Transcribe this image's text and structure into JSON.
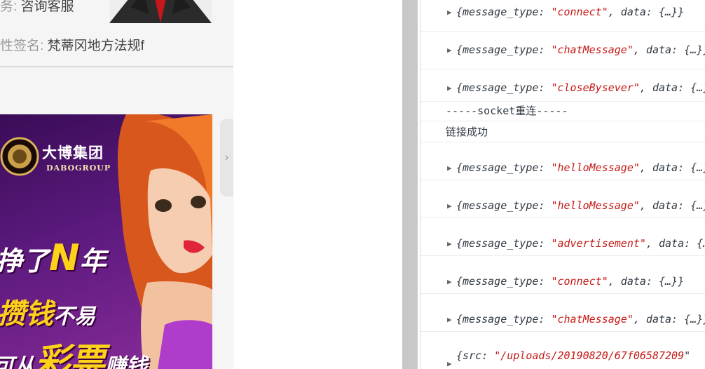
{
  "profile": {
    "service_label": "务:",
    "service_value": "咨询客服",
    "signature_label": "性签名:",
    "signature_value": "梵蒂冈地方法规f"
  },
  "ad": {
    "brand": "大博集团",
    "brand_en": "DABOGROUP",
    "line1_pre": "挣了",
    "line1_big": "N",
    "line1_post": "年",
    "line2_main": "攒钱",
    "line2_small": "不易",
    "line3_pre": "可从",
    "line3_big": "彩票",
    "line3_post": "赚钱"
  },
  "side_arrow": "›",
  "console": {
    "rows": [
      {
        "kind": "obj",
        "key": "{message_type: ",
        "str": "\"connect\"",
        "rest": ", data: {…}}"
      },
      {
        "kind": "obj",
        "key": "{message_type: ",
        "str": "\"chatMessage\"",
        "rest": ", data: {…}}"
      },
      {
        "kind": "obj",
        "key": "{message_type: ",
        "str": "\"closeBysever\"",
        "rest": ", data: {…}}"
      },
      {
        "kind": "plain",
        "text": "-----socket重连-----"
      },
      {
        "kind": "plain",
        "text": "链接成功"
      },
      {
        "kind": "obj",
        "key": "{message_type: ",
        "str": "\"helloMessage\"",
        "rest": ", data: {…}}"
      },
      {
        "kind": "obj",
        "key": "{message_type: ",
        "str": "\"helloMessage\"",
        "rest": ", data: {…}}"
      },
      {
        "kind": "obj",
        "key": "{message_type: ",
        "str": "\"advertisement\"",
        "rest": ", data: {…}}"
      },
      {
        "kind": "obj",
        "key": "{message_type: ",
        "str": "\"connect\"",
        "rest": ", data: {…}}"
      },
      {
        "kind": "obj",
        "key": "{message_type: ",
        "str": "\"chatMessage\"",
        "rest": ", data: {…}}"
      },
      {
        "kind": "obj",
        "key": "{src: ",
        "str": "\"/uploads/20190820/67f06587209",
        "rest": "\""
      }
    ]
  },
  "colors": {
    "string": "#c41a16",
    "ad_yellow": "#ffd21a",
    "ad_bg": "#5c1a7e"
  }
}
